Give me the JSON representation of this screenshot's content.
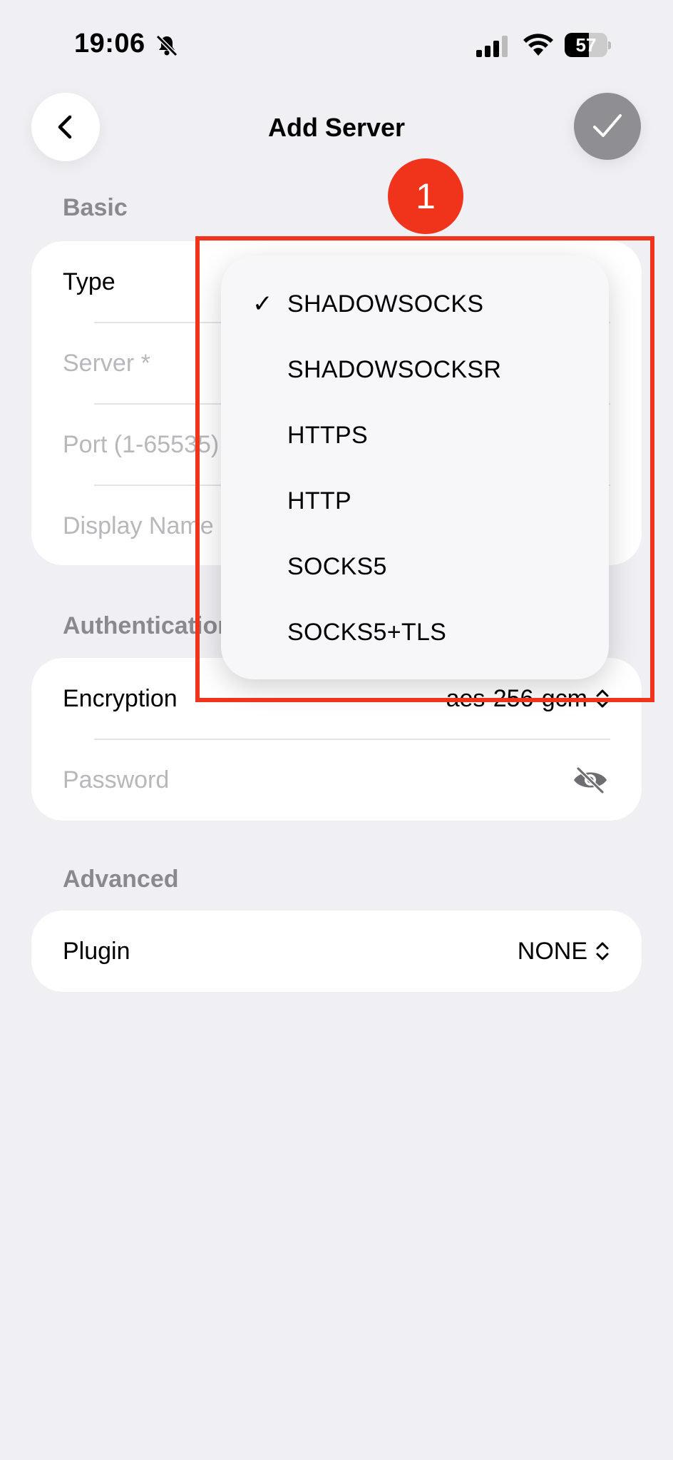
{
  "status_bar": {
    "time": "19:06",
    "battery": "57",
    "battery_level": 0.57
  },
  "nav": {
    "title": "Add Server"
  },
  "sections": {
    "basic": "Basic",
    "authentication": "Authentication",
    "advanced": "Advanced"
  },
  "basic": {
    "type_label": "Type",
    "server_placeholder": "Server *",
    "port_placeholder": "Port (1-65535)",
    "display_name_placeholder": "Display Name"
  },
  "auth": {
    "encryption_label": "Encryption",
    "encryption_value": "aes-256-gcm",
    "password_placeholder": "Password"
  },
  "advanced": {
    "plugin_label": "Plugin",
    "plugin_value": "NONE"
  },
  "type_menu": {
    "selected_index": 0,
    "options": [
      "SHADOWSOCKS",
      "SHADOWSOCKSR",
      "HTTPS",
      "HTTP",
      "SOCKS5",
      "SOCKS5+TLS"
    ]
  },
  "annotation": {
    "badge": "1",
    "color": "#f0331b"
  }
}
